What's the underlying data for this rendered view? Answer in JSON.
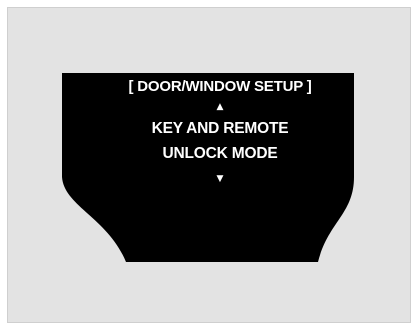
{
  "display": {
    "header": "[ DOOR/WINDOW SETUP ]",
    "up_arrow_icon": "up-triangle",
    "lines": [
      "KEY AND REMOTE",
      "UNLOCK MODE"
    ],
    "down_arrow_icon": "down-triangle"
  },
  "colors": {
    "background": "#e3e3e3",
    "screen": "#000000",
    "text": "#ffffff"
  }
}
